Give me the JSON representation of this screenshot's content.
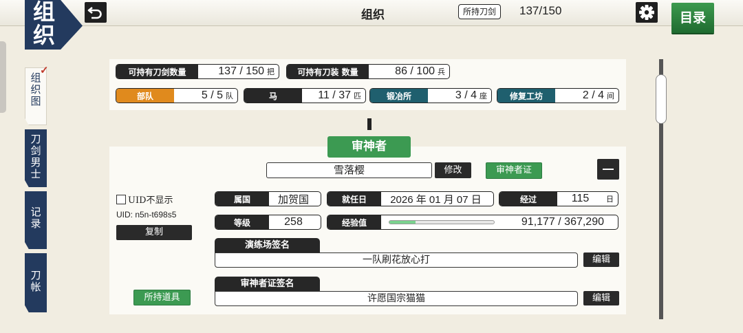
{
  "header": {
    "corner_label": "组织",
    "title": "组织",
    "sword_label": "所持刀剑",
    "sword_count": "137/150",
    "menu_label": "目录"
  },
  "sidebar": {
    "tabs": [
      {
        "label": "组织图"
      },
      {
        "label": "刀剑男士"
      },
      {
        "label": "记录"
      },
      {
        "label": "刀帐"
      }
    ],
    "check_mark": "✓"
  },
  "resources": {
    "blades": {
      "label": "可持有刀剑数量",
      "value": "137 / 150",
      "unit": "把"
    },
    "equipment": {
      "label": "可持有刀装 数量",
      "value": "86 / 100",
      "unit": "兵"
    },
    "units": {
      "label": "部队",
      "value": "5 / 5",
      "unit": "队"
    },
    "horses": {
      "label": "马",
      "value": "11 / 37",
      "unit": "匹"
    },
    "forge": {
      "label": "锻冶所",
      "value": "3 / 4",
      "unit": "座"
    },
    "repair": {
      "label": "修复工坊",
      "value": "2 / 4",
      "unit": "间"
    }
  },
  "saniwa": {
    "header": "审神者",
    "name": "雪落樱",
    "edit_label": "修改",
    "certificate_label": "审神者证",
    "uid_hide_label": "UID不显示",
    "uid_text": "UID: n5n-t698s5",
    "copy_label": "复制",
    "items_label": "所持道具",
    "province": {
      "label": "属国",
      "value": "加贺国"
    },
    "appointed": {
      "label": "就任日",
      "value": "2026 年 01 月 07 日"
    },
    "elapsed": {
      "label": "经过",
      "value": "115",
      "unit": "日"
    },
    "level": {
      "label": "等级",
      "value": "258"
    },
    "exp": {
      "label": "经验值",
      "value": "91,177 / 367,290",
      "fraction": 0.248
    },
    "training_sig": {
      "label": "演练场签名",
      "value": "一队刷花放心打",
      "edit": "编辑"
    },
    "cert_sig": {
      "label": "审神者证签名",
      "value": "许愿国宗猫猫",
      "edit": "编辑"
    }
  }
}
